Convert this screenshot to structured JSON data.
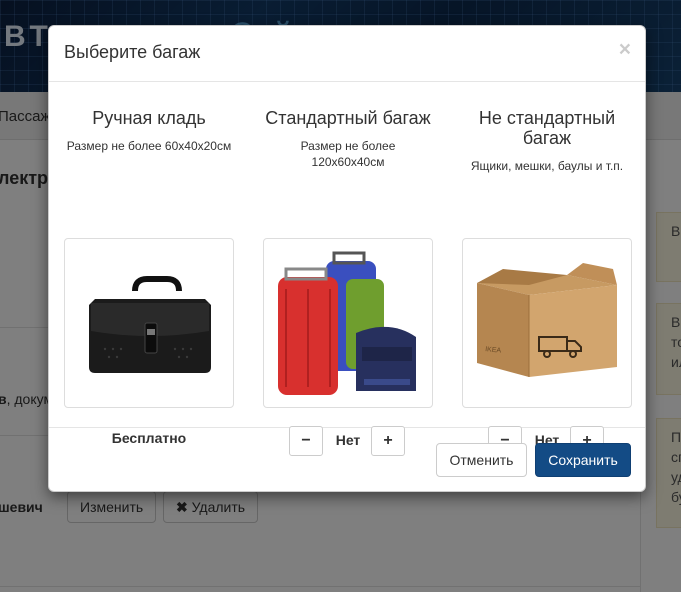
{
  "background": {
    "logo_left": "ВТО",
    "logo_right": "С          й",
    "nav_text": "Пассаж",
    "section_title": "лектр",
    "row_text_bold": "в",
    "row_text": ", докум",
    "person_name": "шевич",
    "edit_button": "Изменить",
    "delete_button": "Удалить",
    "notes": [
      "В м",
      "В то ил",
      "П сп уд бу"
    ]
  },
  "modal": {
    "title": "Выберите багаж",
    "close_symbol": "×",
    "options": [
      {
        "title": "Ручная кладь",
        "description": "Размер не более 60x40x20см",
        "price": "Бесплатно",
        "image": "black-briefcase"
      },
      {
        "title": "Стандартный багаж",
        "description": "Размер не более 120x60x40см",
        "quantity": "Нет",
        "minus": "−",
        "plus": "+",
        "image": "suitcases"
      },
      {
        "title": "Не стандартный багаж",
        "description": "Ящики, мешки, баулы и т.п.",
        "quantity": "Нет",
        "minus": "−",
        "plus": "+",
        "image": "cardboard-box",
        "box_label": "IKEA"
      }
    ],
    "cancel_button": "Отменить",
    "save_button": "Сохранить"
  },
  "colors": {
    "primary": "#134b85",
    "header_bg": "#0c2040",
    "note_bg": "#fcf8e3"
  }
}
